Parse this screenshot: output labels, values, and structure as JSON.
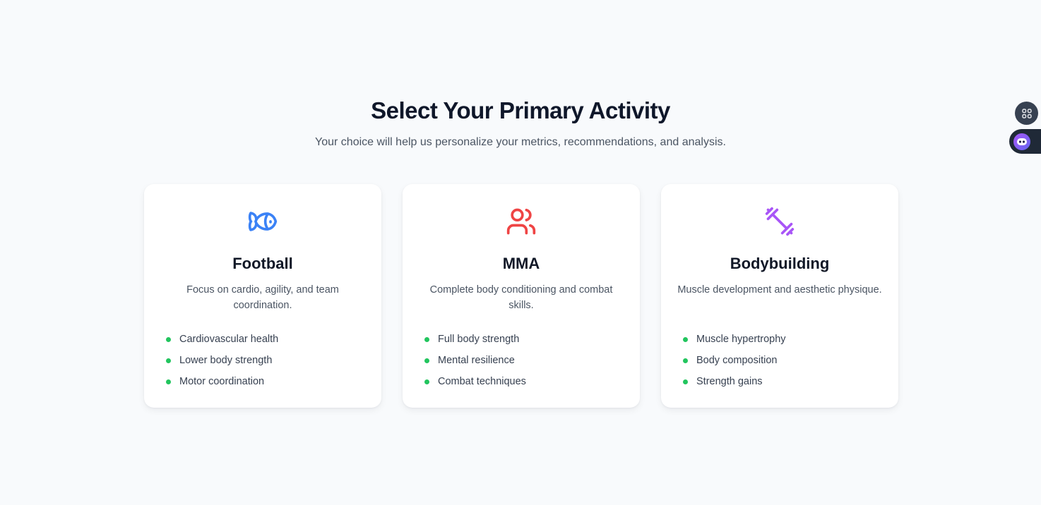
{
  "header": {
    "title": "Select Your Primary Activity",
    "subtitle": "Your choice will help us personalize your metrics, recommendations, and analysis."
  },
  "activities": [
    {
      "title": "Football",
      "description": "Focus on cardio, agility, and team coordination.",
      "icon": "fish-icon",
      "icon_color": "#3b82f6",
      "features": [
        "Cardiovascular health",
        "Lower body strength",
        "Motor coordination"
      ]
    },
    {
      "title": "MMA",
      "description": "Complete body conditioning and combat skills.",
      "icon": "users-icon",
      "icon_color": "#ef4444",
      "features": [
        "Full body strength",
        "Mental resilience",
        "Combat techniques"
      ]
    },
    {
      "title": "Bodybuilding",
      "description": "Muscle development and aesthetic physique.",
      "icon": "dumbbell-icon",
      "icon_color": "#a855f7",
      "features": [
        "Muscle hypertrophy",
        "Body composition",
        "Strength gains"
      ]
    }
  ],
  "colors": {
    "background": "#f8fafc",
    "bullet": "#22c55e",
    "heading": "#0f172a"
  },
  "floating_widgets": {
    "apps_icon": "apps-grid-icon",
    "assistant_icon": "assistant-robot-icon"
  }
}
